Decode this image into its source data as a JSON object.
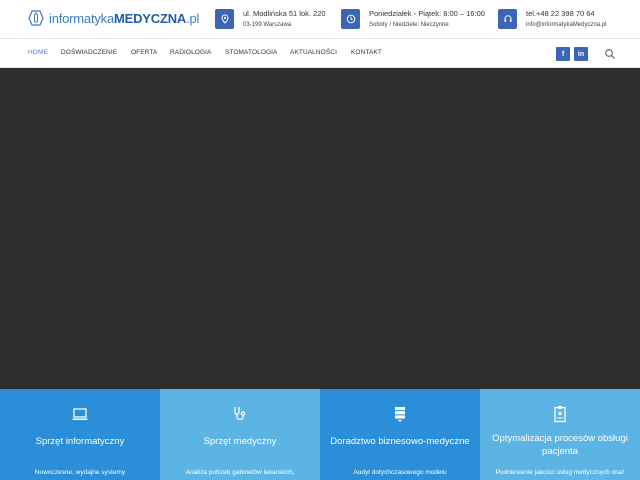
{
  "logo": {
    "part_light": "informatyka",
    "part_bold": "MEDYCZNA",
    "part_tld": ".pl"
  },
  "contact": {
    "address": {
      "line1": "ul. Modlińska 51 lok. 220",
      "line2": "03-199 Warszawa",
      "icon": "map-pin-icon"
    },
    "hours": {
      "line1": "Poniedziałek - Piątek: 8:00 – 16:00",
      "line2": "Soboty / Niedziele: Nieczynne",
      "icon": "clock-icon"
    },
    "phone": {
      "line1": "tel.+48 22 398 70 64",
      "line2": "info@informatykaMedyczna.pl",
      "icon": "headset-icon"
    }
  },
  "nav": {
    "items": [
      "HOME",
      "DOŚWIADCZENIE",
      "OFERTA",
      "RADIOLOGIA",
      "STOMATOLOGIA",
      "AKTUALNOŚCI",
      "KONTAKT"
    ],
    "active_index": 0,
    "social": {
      "facebook": "f",
      "linkedin": "in"
    },
    "search_icon": "search-icon"
  },
  "colors": {
    "brand_blue": "#3a66b5",
    "nav_active": "#3a86d8",
    "hero_bg": "#2d2d2d",
    "tile_1": "#2a8ed8",
    "tile_2": "#5cb4e4",
    "tile_3": "#2a8ed8",
    "tile_4": "#5cb4e4"
  },
  "tiles": [
    {
      "icon": "laptop-icon",
      "title": "Sprzęt informatyczny",
      "desc": "Nowoczesne, wydajne systemy"
    },
    {
      "icon": "stethoscope-icon",
      "title": "Sprzęt medyczny",
      "desc": "Analiza potrzeb gabinetów lekarskich,"
    },
    {
      "icon": "server-icon",
      "title": "Doradztwo biznesowo-medyczne",
      "desc": "Audyt dotychczasowego modelu"
    },
    {
      "icon": "clipboard-icon",
      "title": "Optymalizacja procesów obsługi pacjenta",
      "desc": "Podniesienie jakości usług medycznych oraz"
    }
  ]
}
